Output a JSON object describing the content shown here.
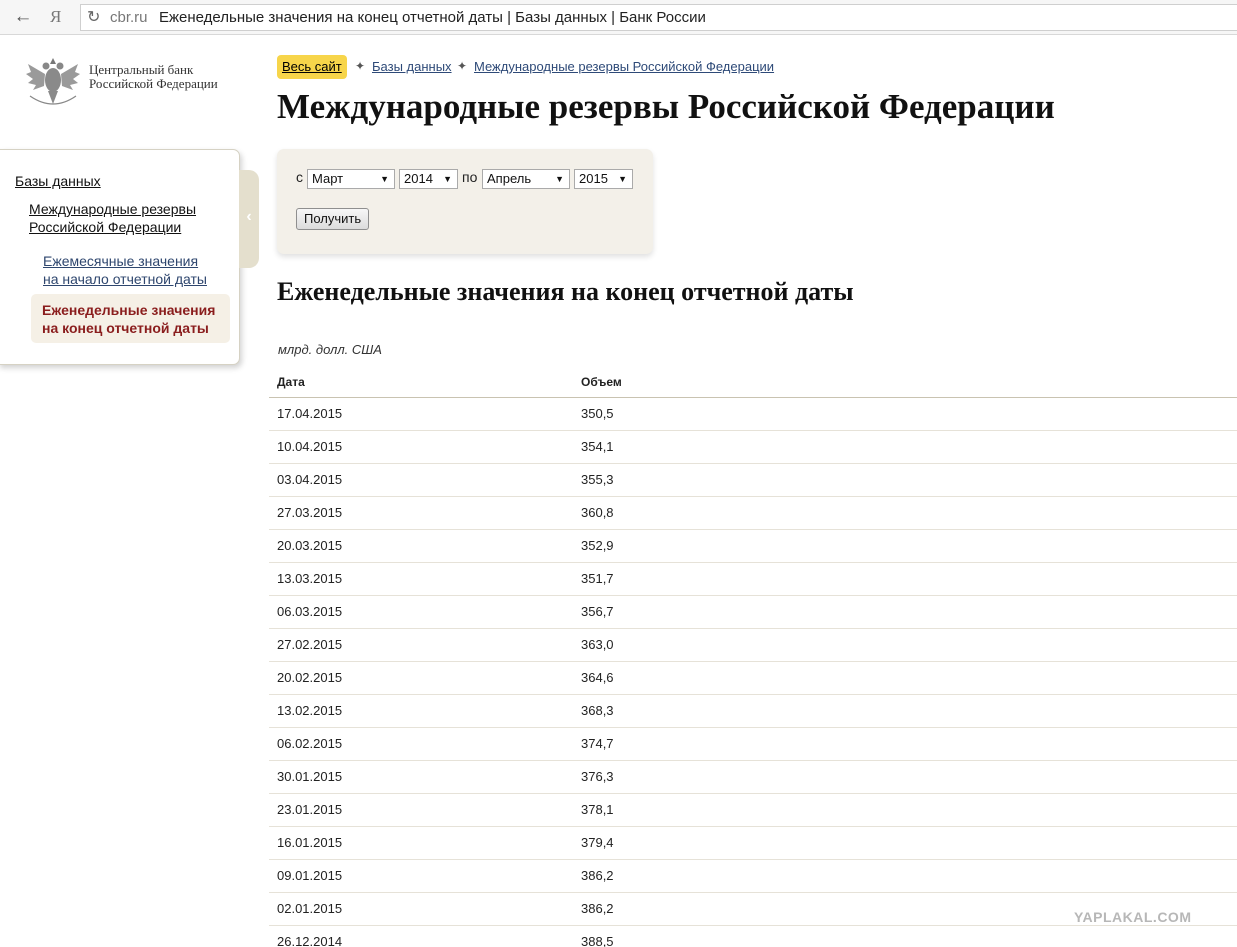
{
  "browser": {
    "back_icon": "arrow-left-icon",
    "yandex_label": "Я",
    "url_domain": "cbr.ru",
    "page_title": "Еженедельные значения на конец отчетной даты | Базы данных | Банк России"
  },
  "logo": {
    "line1": "Центральный банк",
    "line2": "Российской Федерации"
  },
  "sidebar": {
    "databases": "Базы данных",
    "reserves_line1": "Международные резервы",
    "reserves_line2": "Российской Федерации",
    "monthly_line1": "Ежемесячные значения",
    "monthly_line2": "на начало отчетной даты",
    "weekly_line1": "Еженедельные значения",
    "weekly_line2": "на конец отчетной даты",
    "collapse_icon": "chevron-left-icon"
  },
  "breadcrumb": {
    "all_site": "Весь сайт",
    "databases": "Базы данных",
    "reserves": "Международные резервы Российской Федерации",
    "separator": "✦"
  },
  "title": "Международные резервы Российской Федерации",
  "filter": {
    "from_label": "с",
    "from_month": "Март",
    "from_year": "2014",
    "to_label": "по",
    "to_month": "Апрель",
    "to_year": "2015",
    "submit": "Получить"
  },
  "section_title": "Еженедельные значения на конец отчетной даты",
  "units": "млрд. долл. США",
  "table": {
    "headers": [
      "Дата",
      "Объем"
    ],
    "rows": [
      [
        "17.04.2015",
        "350,5"
      ],
      [
        "10.04.2015",
        "354,1"
      ],
      [
        "03.04.2015",
        "355,3"
      ],
      [
        "27.03.2015",
        "360,8"
      ],
      [
        "20.03.2015",
        "352,9"
      ],
      [
        "13.03.2015",
        "351,7"
      ],
      [
        "06.03.2015",
        "356,7"
      ],
      [
        "27.02.2015",
        "363,0"
      ],
      [
        "20.02.2015",
        "364,6"
      ],
      [
        "13.02.2015",
        "368,3"
      ],
      [
        "06.02.2015",
        "374,7"
      ],
      [
        "30.01.2015",
        "376,3"
      ],
      [
        "23.01.2015",
        "378,1"
      ],
      [
        "16.01.2015",
        "379,4"
      ],
      [
        "09.01.2015",
        "386,2"
      ],
      [
        "02.01.2015",
        "386,2"
      ],
      [
        "26.12.2014",
        "388,5"
      ]
    ]
  },
  "watermark": "YAPLAKAL.COM"
}
